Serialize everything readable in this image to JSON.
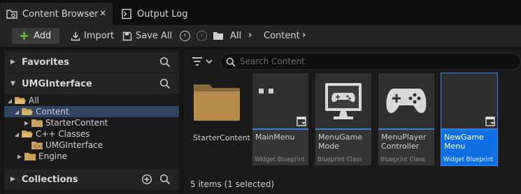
{
  "tabs": [
    {
      "label": "Content Browser",
      "icon": "folder-browser-icon",
      "active": true
    },
    {
      "label": "Output Log",
      "icon": "output-log-icon",
      "active": false
    }
  ],
  "tab_close": "✕",
  "toolbar": {
    "add_label": "Add",
    "import_label": "Import",
    "save_all_label": "Save All",
    "breadcrumb": [
      "All",
      "Content"
    ]
  },
  "sidebar": {
    "favorites_title": "Favorites",
    "project_title": "UMGInterface",
    "collections_title": "Collections",
    "tree": [
      {
        "label": "All",
        "expanded": true
      },
      {
        "label": "Content",
        "expanded": true,
        "selected": true
      },
      {
        "label": "StarterContent",
        "expanded": false
      },
      {
        "label": "C++ Classes",
        "expanded": true
      },
      {
        "label": "UMGInterface",
        "expanded": false
      },
      {
        "label": "Engine",
        "expanded": false
      }
    ]
  },
  "search": {
    "placeholder": "Search Content"
  },
  "assets": [
    {
      "name": "StarterContent",
      "type": "",
      "kind": "folder"
    },
    {
      "name": "MainMenu",
      "type": "Widget Blueprint",
      "kind": "widget"
    },
    {
      "name": "MenuGame Mode",
      "type": "Blueprint Class",
      "kind": "blueprint"
    },
    {
      "name": "MenuPlayer Controller",
      "type": "Blueprint Class",
      "kind": "blueprint"
    },
    {
      "name": "NewGame Menu",
      "type": "Widget Blueprint",
      "kind": "widget",
      "selected": true
    }
  ],
  "status": "5 items (1 selected)",
  "colors": {
    "accent": "#0d6fe2",
    "add_green": "#6fce3f",
    "selection": "#2f4561"
  }
}
